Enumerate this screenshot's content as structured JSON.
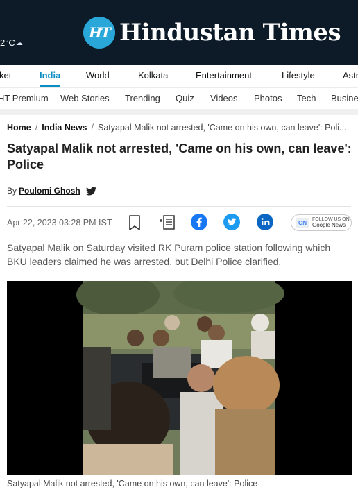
{
  "masthead": {
    "weather": "2°C",
    "logo_badge": "HT",
    "logo_text": "Hindustan Times",
    "cloud_icon": "cloud-icon"
  },
  "nav_primary": [
    "ket",
    "India",
    "World",
    "Kolkata",
    "Entertainment",
    "Lifestyle",
    "Astr"
  ],
  "nav_primary_active": "India",
  "nav_secondary": [
    "HT Premium",
    "Web Stories",
    "Trending",
    "Quiz",
    "Videos",
    "Photos",
    "Tech",
    "Busine"
  ],
  "breadcrumb": {
    "home": "Home",
    "section": "India News",
    "current": "Satyapal Malik not arrested, 'Came on his own, can leave': Poli..."
  },
  "article": {
    "headline": "Satyapal Malik not arrested, 'Came on his own, can leave': Police",
    "byline_prefix": "By",
    "author": "Poulomi Ghosh",
    "date": "Apr 22, 2023 03:28 PM IST",
    "google_news_top": "FOLLOW US ON",
    "google_news_label": "Google News",
    "google_news_logo": "GN",
    "summary": "Satyapal Malik on Saturday visited RK Puram police station following which BKU leaders claimed he was arrested, but Delhi Police clarified.",
    "caption": "Satyapal Malik not arrested, 'Came on his own, can leave': Police"
  },
  "colors": {
    "masthead_bg": "#0d1b28",
    "accent": "#0a8ec2",
    "facebook": "#1877f2",
    "twitter": "#1d9bf0",
    "linkedin": "#0a66c2"
  }
}
